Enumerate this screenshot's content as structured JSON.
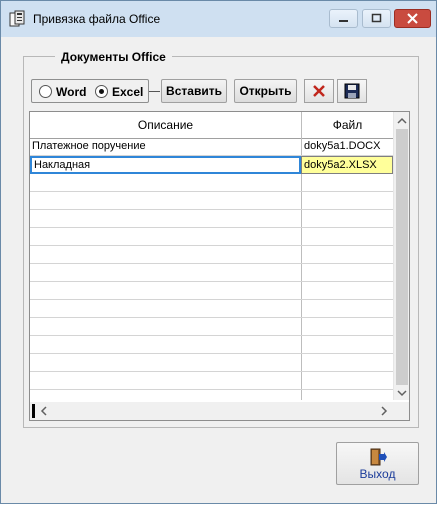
{
  "window": {
    "title": "Привязка файла Office"
  },
  "group": {
    "title": "Документы Office"
  },
  "radio": {
    "options": [
      {
        "label": "Word",
        "checked": false
      },
      {
        "label": "Excel",
        "checked": true
      }
    ]
  },
  "toolbar": {
    "insert_label": "Вставить",
    "open_label": "Открыть",
    "delete_icon": "delete-x-icon",
    "save_icon": "floppy-disk-icon"
  },
  "grid": {
    "columns": [
      "Описание",
      "Файл"
    ],
    "rows": [
      {
        "description": "Платежное поручение",
        "file": "doky5a1.DOCX"
      },
      {
        "description": "Накладная",
        "file": "doky5a2.XLSX"
      }
    ],
    "empty_rows": 12
  },
  "footer": {
    "exit_label": "Выход"
  },
  "colors": {
    "titlebar": "#cfe0f1",
    "selected_cell": "#ffff9a",
    "focus_border": "#2f86d8",
    "close_button": "#c94b3f",
    "delete_icon": "#c0261c"
  }
}
